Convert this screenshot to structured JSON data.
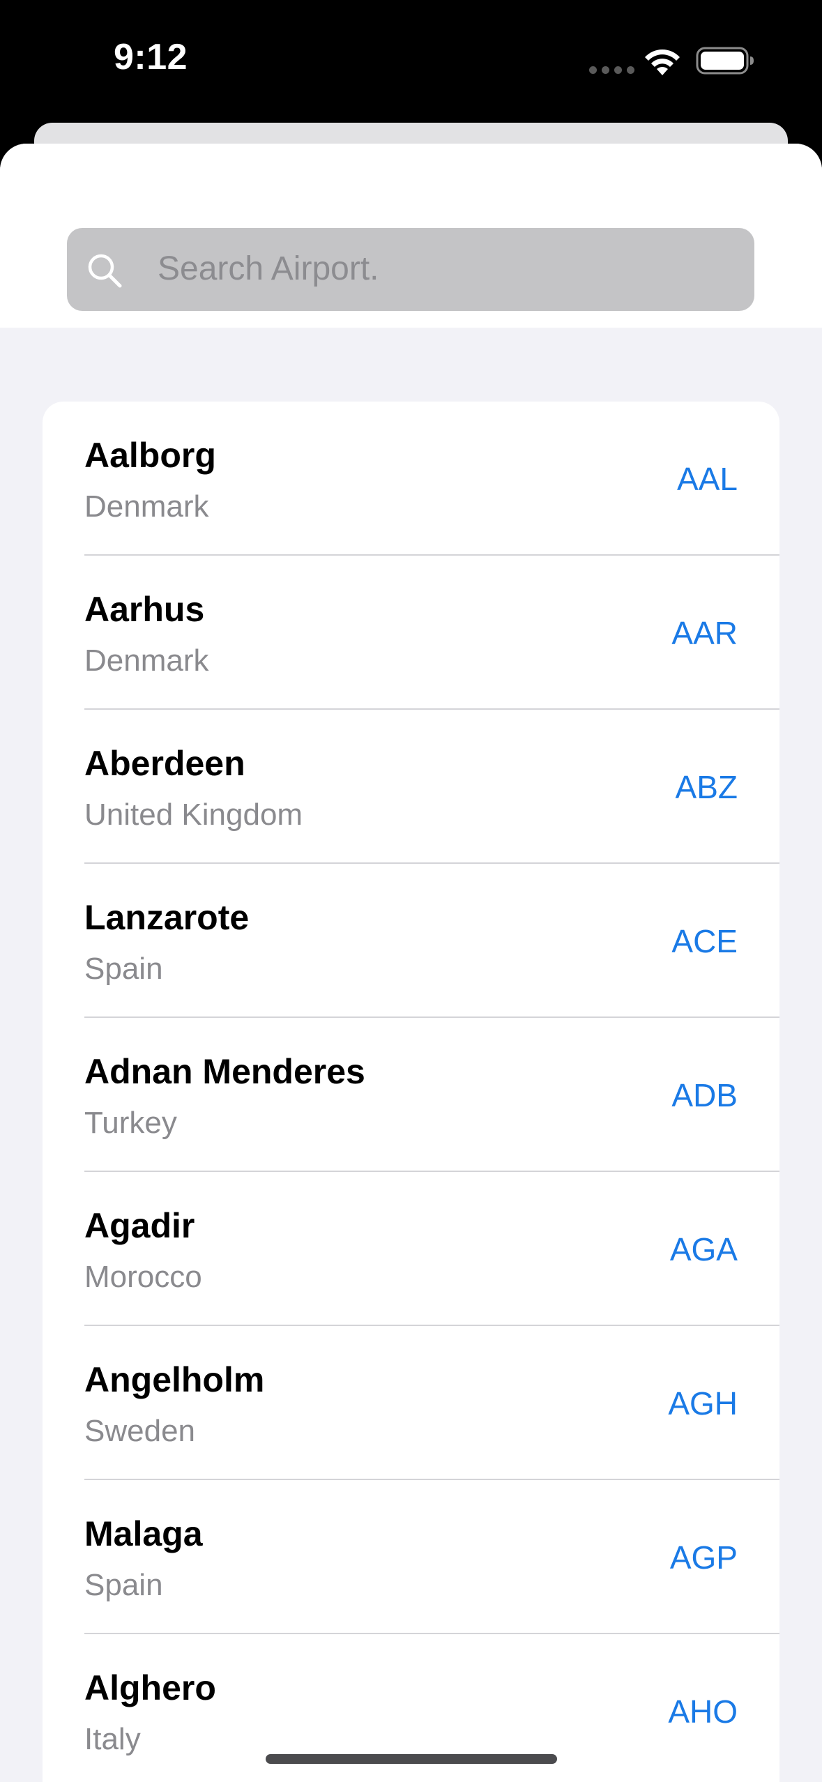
{
  "status_bar": {
    "time": "9:12"
  },
  "search": {
    "placeholder": "Search Airport."
  },
  "airports": [
    {
      "city": "Aalborg",
      "country": "Denmark",
      "code": "AAL"
    },
    {
      "city": "Aarhus",
      "country": "Denmark",
      "code": "AAR"
    },
    {
      "city": "Aberdeen",
      "country": "United Kingdom",
      "code": "ABZ"
    },
    {
      "city": "Lanzarote",
      "country": "Spain",
      "code": "ACE"
    },
    {
      "city": "Adnan Menderes",
      "country": "Turkey",
      "code": "ADB"
    },
    {
      "city": "Agadir",
      "country": "Morocco",
      "code": "AGA"
    },
    {
      "city": "Angelholm",
      "country": "Sweden",
      "code": "AGH"
    },
    {
      "city": "Malaga",
      "country": "Spain",
      "code": "AGP"
    },
    {
      "city": "Alghero",
      "country": "Italy",
      "code": "AHO"
    }
  ],
  "colors": {
    "accent": "#1a7ae6",
    "secondary_text": "#8a8a8e",
    "grouped_background": "#f2f2f7"
  },
  "icons": [
    "wifi-icon",
    "battery-icon",
    "search-icon"
  ]
}
